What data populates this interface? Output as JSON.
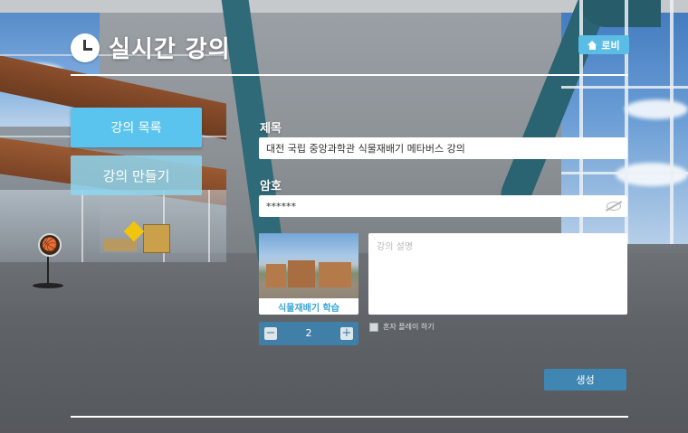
{
  "header": {
    "title": "실시간 강의",
    "lobby_label": "로비"
  },
  "sidebar": {
    "items": [
      {
        "label": "강의 목록",
        "active": true
      },
      {
        "label": "강의 만들기",
        "active": false
      }
    ]
  },
  "form": {
    "title_label": "제목",
    "title_value": "대전 국립 중앙과학관 식물재배기 메타버스 강의",
    "password_label": "암호",
    "password_value": "******",
    "thumbnail_caption": "식물재배기 학습",
    "count_value": "2",
    "decrement_label": "−",
    "increment_label": "+",
    "description_placeholder": "강의 설명",
    "solo_label": "혼자 플레이 하기",
    "create_label": "생성"
  },
  "scene": {
    "ball_glyph": "🏀"
  },
  "colors": {
    "accent": "#5bc4ee",
    "button_dark": "#3f86b3",
    "stepper": "#3f7fa8",
    "caption": "#3aa6d8"
  }
}
